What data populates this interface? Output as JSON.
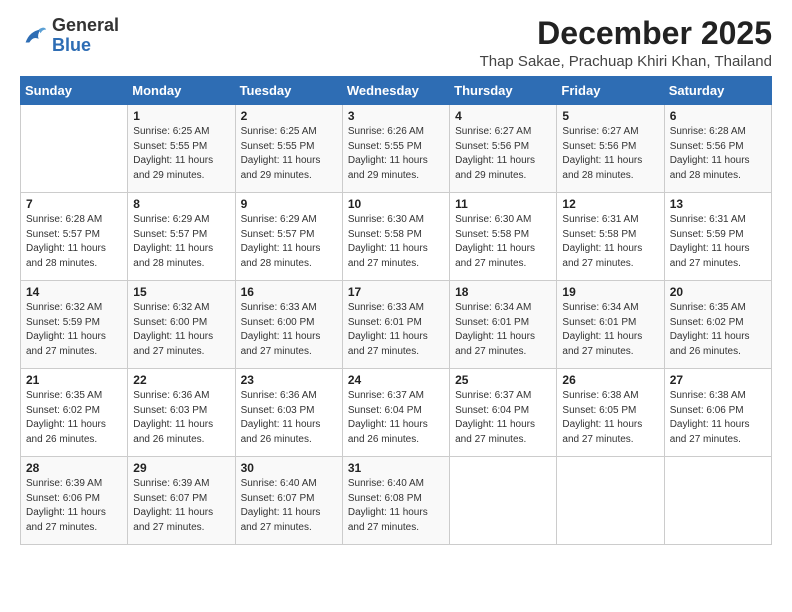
{
  "header": {
    "logo_general": "General",
    "logo_blue": "Blue",
    "month_year": "December 2025",
    "location": "Thap Sakae, Prachuap Khiri Khan, Thailand"
  },
  "days_of_week": [
    "Sunday",
    "Monday",
    "Tuesday",
    "Wednesday",
    "Thursday",
    "Friday",
    "Saturday"
  ],
  "weeks": [
    [
      {
        "day": "",
        "info": ""
      },
      {
        "day": "1",
        "info": "Sunrise: 6:25 AM\nSunset: 5:55 PM\nDaylight: 11 hours\nand 29 minutes."
      },
      {
        "day": "2",
        "info": "Sunrise: 6:25 AM\nSunset: 5:55 PM\nDaylight: 11 hours\nand 29 minutes."
      },
      {
        "day": "3",
        "info": "Sunrise: 6:26 AM\nSunset: 5:55 PM\nDaylight: 11 hours\nand 29 minutes."
      },
      {
        "day": "4",
        "info": "Sunrise: 6:27 AM\nSunset: 5:56 PM\nDaylight: 11 hours\nand 29 minutes."
      },
      {
        "day": "5",
        "info": "Sunrise: 6:27 AM\nSunset: 5:56 PM\nDaylight: 11 hours\nand 28 minutes."
      },
      {
        "day": "6",
        "info": "Sunrise: 6:28 AM\nSunset: 5:56 PM\nDaylight: 11 hours\nand 28 minutes."
      }
    ],
    [
      {
        "day": "7",
        "info": "Sunrise: 6:28 AM\nSunset: 5:57 PM\nDaylight: 11 hours\nand 28 minutes."
      },
      {
        "day": "8",
        "info": "Sunrise: 6:29 AM\nSunset: 5:57 PM\nDaylight: 11 hours\nand 28 minutes."
      },
      {
        "day": "9",
        "info": "Sunrise: 6:29 AM\nSunset: 5:57 PM\nDaylight: 11 hours\nand 28 minutes."
      },
      {
        "day": "10",
        "info": "Sunrise: 6:30 AM\nSunset: 5:58 PM\nDaylight: 11 hours\nand 27 minutes."
      },
      {
        "day": "11",
        "info": "Sunrise: 6:30 AM\nSunset: 5:58 PM\nDaylight: 11 hours\nand 27 minutes."
      },
      {
        "day": "12",
        "info": "Sunrise: 6:31 AM\nSunset: 5:58 PM\nDaylight: 11 hours\nand 27 minutes."
      },
      {
        "day": "13",
        "info": "Sunrise: 6:31 AM\nSunset: 5:59 PM\nDaylight: 11 hours\nand 27 minutes."
      }
    ],
    [
      {
        "day": "14",
        "info": "Sunrise: 6:32 AM\nSunset: 5:59 PM\nDaylight: 11 hours\nand 27 minutes."
      },
      {
        "day": "15",
        "info": "Sunrise: 6:32 AM\nSunset: 6:00 PM\nDaylight: 11 hours\nand 27 minutes."
      },
      {
        "day": "16",
        "info": "Sunrise: 6:33 AM\nSunset: 6:00 PM\nDaylight: 11 hours\nand 27 minutes."
      },
      {
        "day": "17",
        "info": "Sunrise: 6:33 AM\nSunset: 6:01 PM\nDaylight: 11 hours\nand 27 minutes."
      },
      {
        "day": "18",
        "info": "Sunrise: 6:34 AM\nSunset: 6:01 PM\nDaylight: 11 hours\nand 27 minutes."
      },
      {
        "day": "19",
        "info": "Sunrise: 6:34 AM\nSunset: 6:01 PM\nDaylight: 11 hours\nand 27 minutes."
      },
      {
        "day": "20",
        "info": "Sunrise: 6:35 AM\nSunset: 6:02 PM\nDaylight: 11 hours\nand 26 minutes."
      }
    ],
    [
      {
        "day": "21",
        "info": "Sunrise: 6:35 AM\nSunset: 6:02 PM\nDaylight: 11 hours\nand 26 minutes."
      },
      {
        "day": "22",
        "info": "Sunrise: 6:36 AM\nSunset: 6:03 PM\nDaylight: 11 hours\nand 26 minutes."
      },
      {
        "day": "23",
        "info": "Sunrise: 6:36 AM\nSunset: 6:03 PM\nDaylight: 11 hours\nand 26 minutes."
      },
      {
        "day": "24",
        "info": "Sunrise: 6:37 AM\nSunset: 6:04 PM\nDaylight: 11 hours\nand 26 minutes."
      },
      {
        "day": "25",
        "info": "Sunrise: 6:37 AM\nSunset: 6:04 PM\nDaylight: 11 hours\nand 27 minutes."
      },
      {
        "day": "26",
        "info": "Sunrise: 6:38 AM\nSunset: 6:05 PM\nDaylight: 11 hours\nand 27 minutes."
      },
      {
        "day": "27",
        "info": "Sunrise: 6:38 AM\nSunset: 6:06 PM\nDaylight: 11 hours\nand 27 minutes."
      }
    ],
    [
      {
        "day": "28",
        "info": "Sunrise: 6:39 AM\nSunset: 6:06 PM\nDaylight: 11 hours\nand 27 minutes."
      },
      {
        "day": "29",
        "info": "Sunrise: 6:39 AM\nSunset: 6:07 PM\nDaylight: 11 hours\nand 27 minutes."
      },
      {
        "day": "30",
        "info": "Sunrise: 6:40 AM\nSunset: 6:07 PM\nDaylight: 11 hours\nand 27 minutes."
      },
      {
        "day": "31",
        "info": "Sunrise: 6:40 AM\nSunset: 6:08 PM\nDaylight: 11 hours\nand 27 minutes."
      },
      {
        "day": "",
        "info": ""
      },
      {
        "day": "",
        "info": ""
      },
      {
        "day": "",
        "info": ""
      }
    ]
  ]
}
